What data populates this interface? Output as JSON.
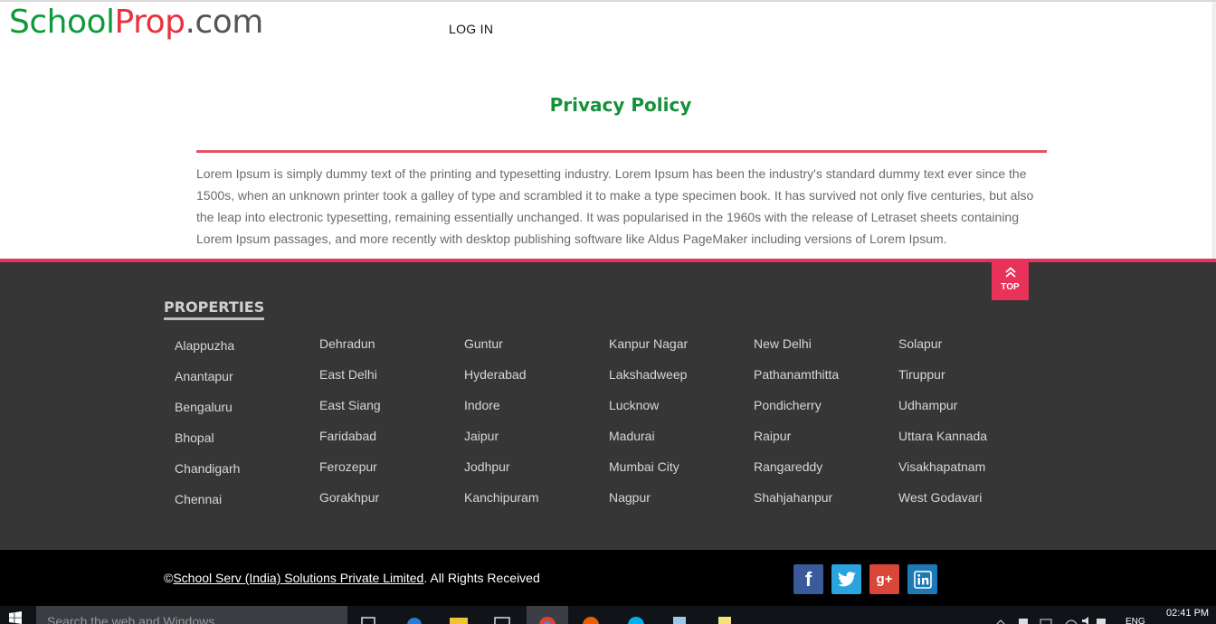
{
  "header": {
    "logo": {
      "part1": "School",
      "part2": "Prop",
      "part3": ".com"
    },
    "login_label": "LOG IN"
  },
  "content": {
    "title": "Privacy Policy",
    "body": "Lorem Ipsum is simply dummy text of the printing and typesetting industry. Lorem Ipsum has been the industry's standard dummy text ever since the 1500s, when an unknown printer took a galley of type and scrambled it to make a type specimen book. It has survived not only five centuries, but also the leap into electronic typesetting, remaining essentially unchanged. It was popularised in the 1960s with the release of Letraset sheets containing Lorem Ipsum passages, and more recently with desktop publishing software like Aldus PageMaker including versions of Lorem Ipsum."
  },
  "footer": {
    "top_button_label": "TOP",
    "properties_heading": "PROPERTIES",
    "columns": [
      [
        "Alappuzha",
        "Anantapur",
        "Bengaluru",
        "Bhopal",
        "Chandigarh",
        "Chennai"
      ],
      [
        "Dehradun",
        "East Delhi",
        "East Siang",
        "Faridabad",
        "Ferozepur",
        "Gorakhpur"
      ],
      [
        "Guntur",
        "Hyderabad",
        "Indore",
        "Jaipur",
        "Jodhpur",
        "Kanchipuram"
      ],
      [
        "Kanpur Nagar",
        "Lakshadweep",
        "Lucknow",
        "Madurai",
        "Mumbai City",
        "Nagpur"
      ],
      [
        "New Delhi",
        "Pathanamthitta",
        "Pondicherry",
        "Raipur",
        "Rangareddy",
        "Shahjahanpur"
      ],
      [
        "Solapur",
        "Tiruppur",
        "Udhampur",
        "Uttara Kannada",
        "Visakhapatnam",
        "West Godavari"
      ]
    ],
    "copyright_prefix": "©",
    "copyright_company": "School Serv (India) Solutions Private Limited",
    "copyright_suffix": ". All Rights Received",
    "social": {
      "facebook": "f",
      "googleplus": "g+"
    }
  },
  "taskbar": {
    "search_placeholder": "Search the web and Windows",
    "language": "ENG",
    "time": "02:41 PM"
  },
  "colors": {
    "brand_green": "#0e9a3a",
    "brand_red": "#e8323c",
    "accent_pink": "#e8325a",
    "footer_bg": "#363636"
  }
}
